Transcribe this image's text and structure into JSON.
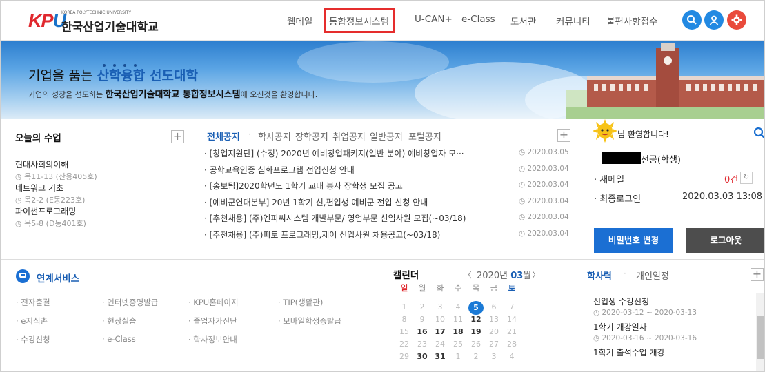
{
  "logo": {
    "en": "KOREA POLYTECHNIC UNIVERSITY",
    "ko": "한국산업기술대학교",
    "mark": "KPU"
  },
  "gnb": [
    {
      "label": "웹메일",
      "active": false
    },
    {
      "label": "통합정보시스템",
      "active": true
    },
    {
      "label": "U-CAN+",
      "active": false
    },
    {
      "label": "e-Class",
      "active": false
    },
    {
      "label": "도서관",
      "active": false
    },
    {
      "label": "커뮤니티",
      "active": false
    },
    {
      "label": "불편사항접수",
      "active": false
    }
  ],
  "header_icons": [
    {
      "name": "search-icon",
      "color": "#2289e2"
    },
    {
      "name": "user-icon",
      "color": "#2289e2"
    },
    {
      "name": "gear-icon",
      "color": "#e94b3c"
    }
  ],
  "banner": {
    "title_plain": "기업을 품는 ",
    "title_highlight": "산학융합 선도대학",
    "sub_before": "기업의 성장을 선도하는 ",
    "sub_bold": "한국산업기술대학교 통합정보시스템",
    "sub_after": "에 오신것을 환영합니다."
  },
  "today": {
    "title": "오늘의 수업",
    "plus": "+",
    "classes": [
      {
        "name": "현대사회의이해",
        "time": "◷ 목11-13 (산융405호)"
      },
      {
        "name": "네트워크 기초",
        "time": "◷ 목2-2 (E동223호)"
      },
      {
        "name": "파이썬프로그래밍",
        "time": "◷ 목5-8 (D동401호)"
      }
    ]
  },
  "notices": {
    "tabs": [
      "전체공지",
      "학사공지",
      "장학공지",
      "취업공지",
      "일반공지",
      "포털공지"
    ],
    "separator": "·",
    "plus": "+",
    "items": [
      {
        "title": "· [창업지원단] (수정) 2020년 예비창업패키지(일반 분야) 예비창업자 모···",
        "date": "◷ 2020.03.05"
      },
      {
        "title": "· 공학교육인증 심화프로그램 전입신청 안내",
        "date": "◷ 2020.03.04"
      },
      {
        "title": "· [홍보팀]2020학년도 1학기 교내 봉사 장학생 모집 공고",
        "date": "◷ 2020.03.04"
      },
      {
        "title": "· [예비군연대본부] 20년 1학기 신,편입생 예비군 전입 신청 안내",
        "date": "◷ 2020.03.04"
      },
      {
        "title": "· [추천채용] (주)엔피씨시스템 개발부문/ 영업부문 신입사원 모집(~03/18)",
        "date": "◷ 2020.03.04"
      },
      {
        "title": "· [추천채용] (주)피토 프로그래밍,제어 신입사원 채용공고(~03/18)",
        "date": "◷ 2020.03.04"
      }
    ]
  },
  "user": {
    "welcome": "님 환영합니다!",
    "major": "전공(학생)",
    "mail_label": "· 새메일",
    "mail_count": "0건",
    "login_label": "· 최종로그인",
    "login_time": "2020.03.03 13:08",
    "btn_pw": "비밀번호 변경",
    "btn_logout": "로그아웃"
  },
  "services": {
    "title": "연계서비스",
    "items": [
      [
        "· 전자출결",
        "· 인터넷증명발급",
        "· KPU홈페이지",
        "· TIP(생활관)"
      ],
      [
        "· e지식촌",
        "· 현장실습",
        "· 졸업자가진단",
        "· 모바일학생증발급"
      ],
      [
        "· 수강신청",
        "· e-Class",
        "· 학사정보안내",
        ""
      ]
    ]
  },
  "calendar": {
    "title": "캘린더",
    "prev": "〈",
    "next": "〉",
    "year_label": "2020년",
    "month": "03",
    "month_suffix": "월",
    "weekdays": [
      "일",
      "월",
      "화",
      "수",
      "목",
      "금",
      "토"
    ],
    "weeks": [
      [
        "1",
        "2",
        "3",
        "4",
        "5",
        "6",
        "7"
      ],
      [
        "8",
        "9",
        "10",
        "11",
        "12",
        "13",
        "14"
      ],
      [
        "15",
        "16",
        "17",
        "18",
        "19",
        "20",
        "21"
      ],
      [
        "22",
        "23",
        "24",
        "25",
        "26",
        "27",
        "28"
      ],
      [
        "29",
        "30",
        "31",
        "1",
        "2",
        "3",
        "4"
      ]
    ],
    "today": "5",
    "bold_days": [
      "12",
      "16",
      "17",
      "18",
      "19",
      "30",
      "31"
    ]
  },
  "academic": {
    "tabs": [
      "학사력",
      "개인일정"
    ],
    "separator": "·",
    "plus": "+",
    "items": [
      {
        "title": "신입생 수강신청",
        "date": "◷ 2020-03-12 ~ 2020-03-13"
      },
      {
        "title": "1학기 개강일자",
        "date": "◷ 2020-03-16 ~ 2020-03-16"
      },
      {
        "title": "1학기 출석수업 개강",
        "date": ""
      }
    ]
  },
  "colors": {
    "brand_blue": "#1a5fb4",
    "brand_red": "#e0282e",
    "btn_blue": "#1b6fd3",
    "btn_dark": "#4d4d4d"
  }
}
